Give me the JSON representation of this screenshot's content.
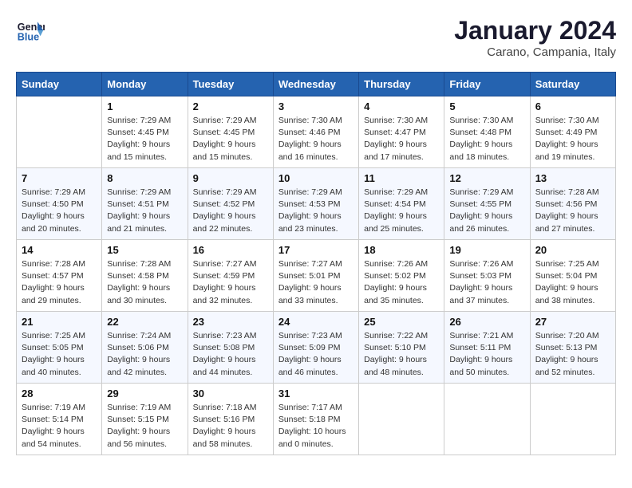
{
  "header": {
    "logo_line1": "General",
    "logo_line2": "Blue",
    "month": "January 2024",
    "location": "Carano, Campania, Italy"
  },
  "days_of_week": [
    "Sunday",
    "Monday",
    "Tuesday",
    "Wednesday",
    "Thursday",
    "Friday",
    "Saturday"
  ],
  "weeks": [
    [
      {
        "day": "",
        "info": ""
      },
      {
        "day": "1",
        "info": "Sunrise: 7:29 AM\nSunset: 4:45 PM\nDaylight: 9 hours\nand 15 minutes."
      },
      {
        "day": "2",
        "info": "Sunrise: 7:29 AM\nSunset: 4:45 PM\nDaylight: 9 hours\nand 15 minutes."
      },
      {
        "day": "3",
        "info": "Sunrise: 7:30 AM\nSunset: 4:46 PM\nDaylight: 9 hours\nand 16 minutes."
      },
      {
        "day": "4",
        "info": "Sunrise: 7:30 AM\nSunset: 4:47 PM\nDaylight: 9 hours\nand 17 minutes."
      },
      {
        "day": "5",
        "info": "Sunrise: 7:30 AM\nSunset: 4:48 PM\nDaylight: 9 hours\nand 18 minutes."
      },
      {
        "day": "6",
        "info": "Sunrise: 7:30 AM\nSunset: 4:49 PM\nDaylight: 9 hours\nand 19 minutes."
      }
    ],
    [
      {
        "day": "7",
        "info": "Sunrise: 7:29 AM\nSunset: 4:50 PM\nDaylight: 9 hours\nand 20 minutes."
      },
      {
        "day": "8",
        "info": "Sunrise: 7:29 AM\nSunset: 4:51 PM\nDaylight: 9 hours\nand 21 minutes."
      },
      {
        "day": "9",
        "info": "Sunrise: 7:29 AM\nSunset: 4:52 PM\nDaylight: 9 hours\nand 22 minutes."
      },
      {
        "day": "10",
        "info": "Sunrise: 7:29 AM\nSunset: 4:53 PM\nDaylight: 9 hours\nand 23 minutes."
      },
      {
        "day": "11",
        "info": "Sunrise: 7:29 AM\nSunset: 4:54 PM\nDaylight: 9 hours\nand 25 minutes."
      },
      {
        "day": "12",
        "info": "Sunrise: 7:29 AM\nSunset: 4:55 PM\nDaylight: 9 hours\nand 26 minutes."
      },
      {
        "day": "13",
        "info": "Sunrise: 7:28 AM\nSunset: 4:56 PM\nDaylight: 9 hours\nand 27 minutes."
      }
    ],
    [
      {
        "day": "14",
        "info": "Sunrise: 7:28 AM\nSunset: 4:57 PM\nDaylight: 9 hours\nand 29 minutes."
      },
      {
        "day": "15",
        "info": "Sunrise: 7:28 AM\nSunset: 4:58 PM\nDaylight: 9 hours\nand 30 minutes."
      },
      {
        "day": "16",
        "info": "Sunrise: 7:27 AM\nSunset: 4:59 PM\nDaylight: 9 hours\nand 32 minutes."
      },
      {
        "day": "17",
        "info": "Sunrise: 7:27 AM\nSunset: 5:01 PM\nDaylight: 9 hours\nand 33 minutes."
      },
      {
        "day": "18",
        "info": "Sunrise: 7:26 AM\nSunset: 5:02 PM\nDaylight: 9 hours\nand 35 minutes."
      },
      {
        "day": "19",
        "info": "Sunrise: 7:26 AM\nSunset: 5:03 PM\nDaylight: 9 hours\nand 37 minutes."
      },
      {
        "day": "20",
        "info": "Sunrise: 7:25 AM\nSunset: 5:04 PM\nDaylight: 9 hours\nand 38 minutes."
      }
    ],
    [
      {
        "day": "21",
        "info": "Sunrise: 7:25 AM\nSunset: 5:05 PM\nDaylight: 9 hours\nand 40 minutes."
      },
      {
        "day": "22",
        "info": "Sunrise: 7:24 AM\nSunset: 5:06 PM\nDaylight: 9 hours\nand 42 minutes."
      },
      {
        "day": "23",
        "info": "Sunrise: 7:23 AM\nSunset: 5:08 PM\nDaylight: 9 hours\nand 44 minutes."
      },
      {
        "day": "24",
        "info": "Sunrise: 7:23 AM\nSunset: 5:09 PM\nDaylight: 9 hours\nand 46 minutes."
      },
      {
        "day": "25",
        "info": "Sunrise: 7:22 AM\nSunset: 5:10 PM\nDaylight: 9 hours\nand 48 minutes."
      },
      {
        "day": "26",
        "info": "Sunrise: 7:21 AM\nSunset: 5:11 PM\nDaylight: 9 hours\nand 50 minutes."
      },
      {
        "day": "27",
        "info": "Sunrise: 7:20 AM\nSunset: 5:13 PM\nDaylight: 9 hours\nand 52 minutes."
      }
    ],
    [
      {
        "day": "28",
        "info": "Sunrise: 7:19 AM\nSunset: 5:14 PM\nDaylight: 9 hours\nand 54 minutes."
      },
      {
        "day": "29",
        "info": "Sunrise: 7:19 AM\nSunset: 5:15 PM\nDaylight: 9 hours\nand 56 minutes."
      },
      {
        "day": "30",
        "info": "Sunrise: 7:18 AM\nSunset: 5:16 PM\nDaylight: 9 hours\nand 58 minutes."
      },
      {
        "day": "31",
        "info": "Sunrise: 7:17 AM\nSunset: 5:18 PM\nDaylight: 10 hours\nand 0 minutes."
      },
      {
        "day": "",
        "info": ""
      },
      {
        "day": "",
        "info": ""
      },
      {
        "day": "",
        "info": ""
      }
    ]
  ]
}
